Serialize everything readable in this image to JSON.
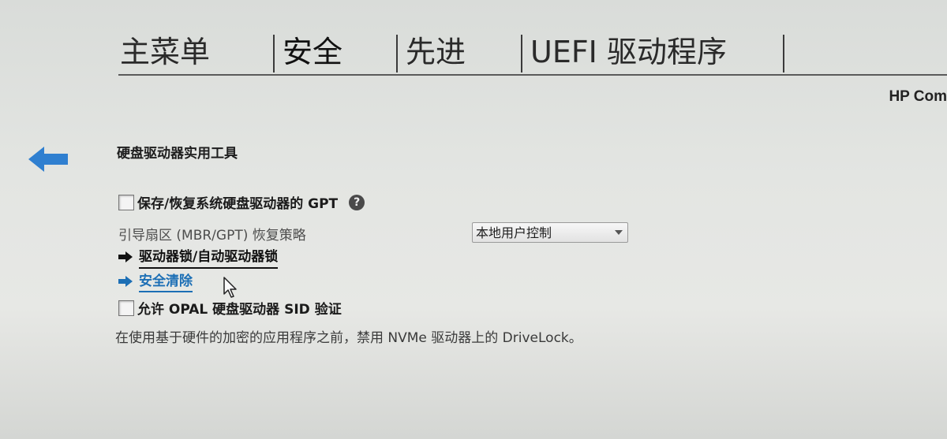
{
  "tabs": [
    {
      "label": "主菜单"
    },
    {
      "label": "安全"
    },
    {
      "label": "先进"
    },
    {
      "label": "UEFI 驱动程序"
    }
  ],
  "brand": "HP Com",
  "section_title": "硬盘驱动器实用工具",
  "gpt_option": {
    "label": "保存/恢复系统硬盘驱动器的 GPT",
    "help": "?"
  },
  "policy": {
    "label": "引导扇区 (MBR/GPT) 恢复策略",
    "value": "本地用户控制"
  },
  "links": {
    "drive_lock": "驱动器锁/自动驱动器锁",
    "secure_erase": "安全清除"
  },
  "opal_option": {
    "label": "允许 OPAL 硬盘驱动器 SID 验证"
  },
  "note": "在使用基于硬件的加密的应用程序之前，禁用 NVMe 驱动器上的 DriveLock。",
  "colors": {
    "accent_blue": "#1c6fb5",
    "back_arrow": "#2f7fd0"
  }
}
